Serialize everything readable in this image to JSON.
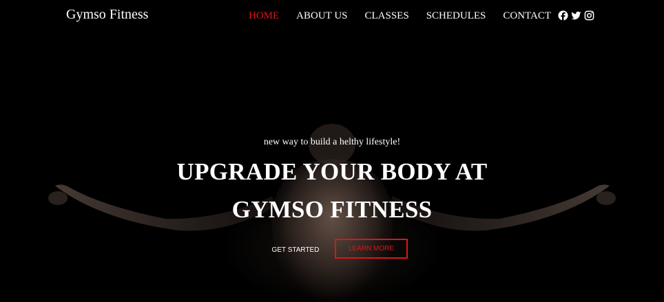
{
  "colors": {
    "accent": "#e0131a",
    "background": "#000000",
    "text": "#ffffff"
  },
  "navbar": {
    "brand": "Gymso Fitness",
    "links": [
      "HOME",
      "ABOUT US",
      "CLASSES",
      "SCHEDULES",
      "CONTACT"
    ],
    "active_link": "HOME",
    "social_icons": [
      "facebook-icon",
      "twitter-icon",
      "instagram-icon"
    ]
  },
  "hero": {
    "tagline": "new way to build a helthy lifestyle!",
    "headline_line1": "UPGRADE YOUR BODY AT",
    "headline_line2": "GYMSO FITNESS",
    "primary_button": "GET STARTED",
    "secondary_button": "LEARN MORE"
  }
}
